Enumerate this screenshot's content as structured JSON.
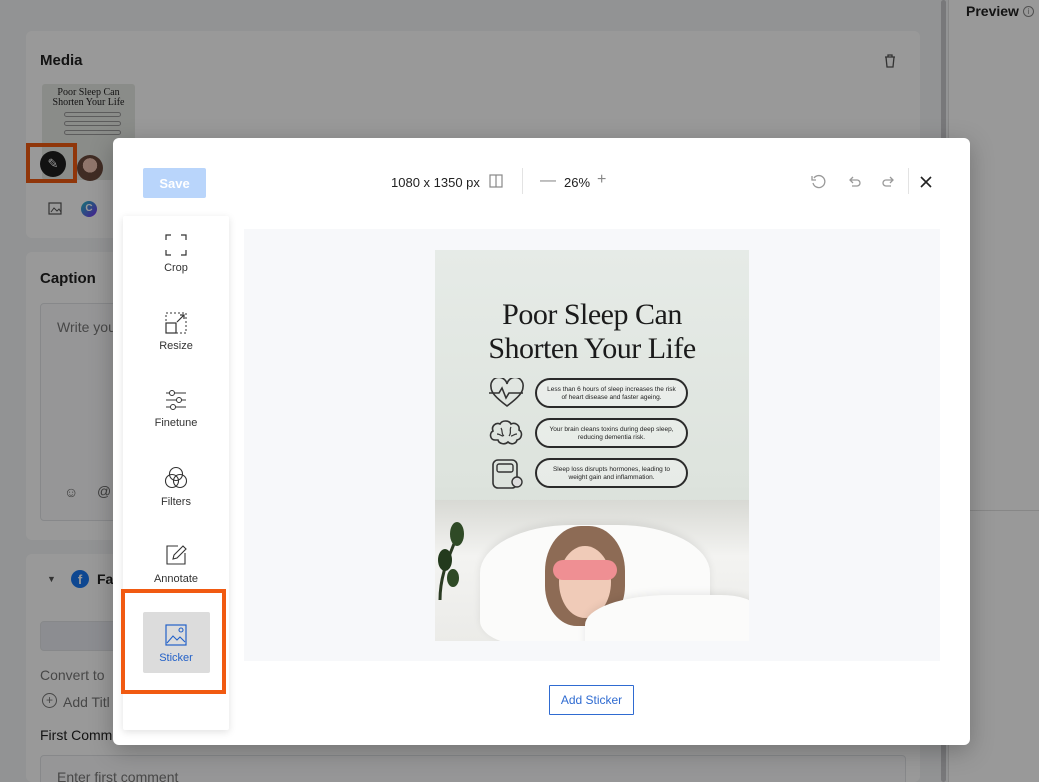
{
  "background": {
    "media_title": "Media",
    "preview_label": "Preview",
    "preview_info_icon": "info-icon",
    "caption_title": "Caption",
    "caption_placeholder": "Write you",
    "network_label": "Fa",
    "convert_label": "Convert to",
    "add_title_label": "Add Titl",
    "first_comment_title": "First Comm",
    "first_comment_placeholder": "Enter first comment",
    "thumbnail_title": "Poor Sleep Can Shorten Your Life"
  },
  "modal": {
    "save_label": "Save",
    "dimensions": "1080 x 1350 px",
    "zoom_value": "26%",
    "tools": [
      {
        "id": "crop",
        "label": "Crop",
        "icon": "crop-icon"
      },
      {
        "id": "resize",
        "label": "Resize",
        "icon": "resize-icon"
      },
      {
        "id": "finetune",
        "label": "Finetune",
        "icon": "sliders-icon"
      },
      {
        "id": "filters",
        "label": "Filters",
        "icon": "filters-icon"
      },
      {
        "id": "annotate",
        "label": "Annotate",
        "icon": "pencil-icon"
      },
      {
        "id": "sticker",
        "label": "Sticker",
        "icon": "sticker-icon",
        "active": true
      }
    ],
    "add_sticker_label": "Add Sticker"
  },
  "poster": {
    "title_line1": "Poor Sleep Can",
    "title_line2": "Shorten Your Life",
    "facts": [
      {
        "icon": "heart-rate-icon",
        "text": "Less than 6 hours of sleep increases the risk of heart disease and faster ageing."
      },
      {
        "icon": "brain-icon",
        "text": "Your brain cleans toxins during deep sleep, reducing dementia risk."
      },
      {
        "icon": "scale-icon",
        "text": "Sleep loss disrupts hormones, leading to weight gain and inflammation."
      }
    ]
  },
  "colors": {
    "highlight": "#f15a11",
    "accent": "#2f6bd1",
    "save_disabled": "#b9d5fb"
  }
}
